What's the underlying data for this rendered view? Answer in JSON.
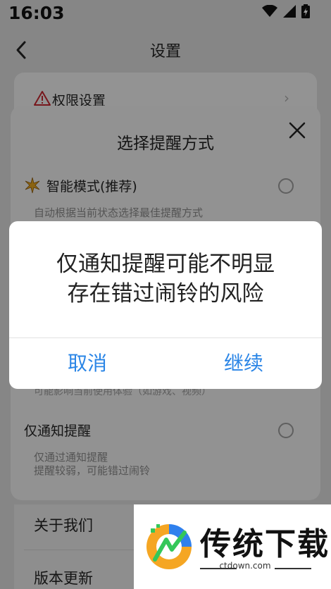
{
  "status_bar": {
    "time": "16:03"
  },
  "header": {
    "title": "设置"
  },
  "settings": {
    "permission_label": "权限设置",
    "about_label": "关于我们",
    "version_label": "版本更新"
  },
  "sheet": {
    "title": "选择提醒方式",
    "smart_mode": {
      "label": "智能模式(推荐)",
      "description": "自动根据当前状态选择最佳提醒方式"
    },
    "performance_note": "可能影响当前使用体验（如游戏、视频）",
    "notify_only": {
      "label": "仅通知提醒",
      "description_line1": "仅通过通知提醒",
      "description_line2": "提醒较弱，可能错过闹铃"
    }
  },
  "dialog": {
    "message_line1": "仅通知提醒可能不明显",
    "message_line2": "存在错过闹铃的风险",
    "cancel_label": "取消",
    "continue_label": "继续",
    "button_color": "#2a85e6"
  },
  "watermark": {
    "brand": "传统下载",
    "url": "ctdown.com"
  }
}
